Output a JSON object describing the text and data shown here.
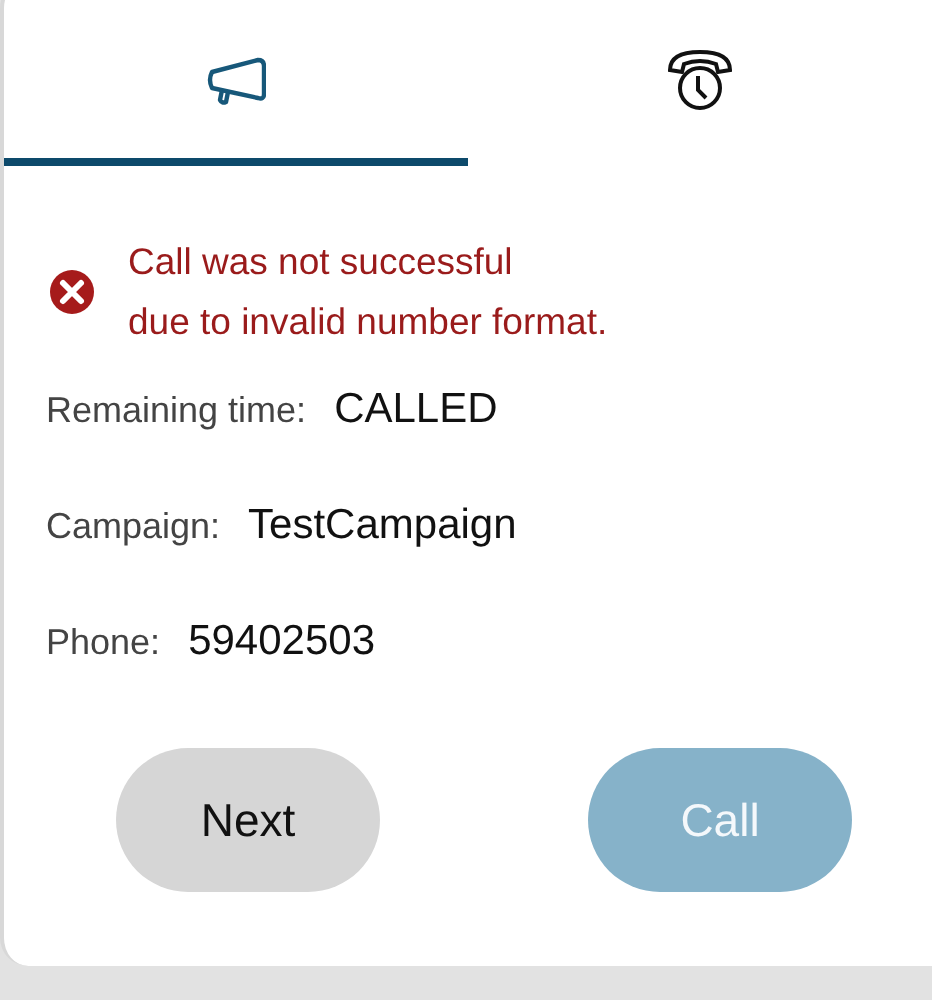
{
  "tabs": [
    {
      "kind": "megaphone",
      "selected": true
    },
    {
      "kind": "phone-clock",
      "selected": false
    }
  ],
  "error": {
    "lines": [
      "Call was not successful",
      "due to invalid number format."
    ]
  },
  "fields": [
    {
      "label": "Remaining time:",
      "value": "CALLED"
    },
    {
      "label": "Campaign:",
      "value": "TestCampaign"
    },
    {
      "label": "Phone:",
      "value": "59402503"
    }
  ],
  "buttons": [
    {
      "label": "Next",
      "kind": "secondary",
      "disabled": false
    },
    {
      "label": "Call",
      "kind": "primary",
      "disabled": true
    }
  ]
}
